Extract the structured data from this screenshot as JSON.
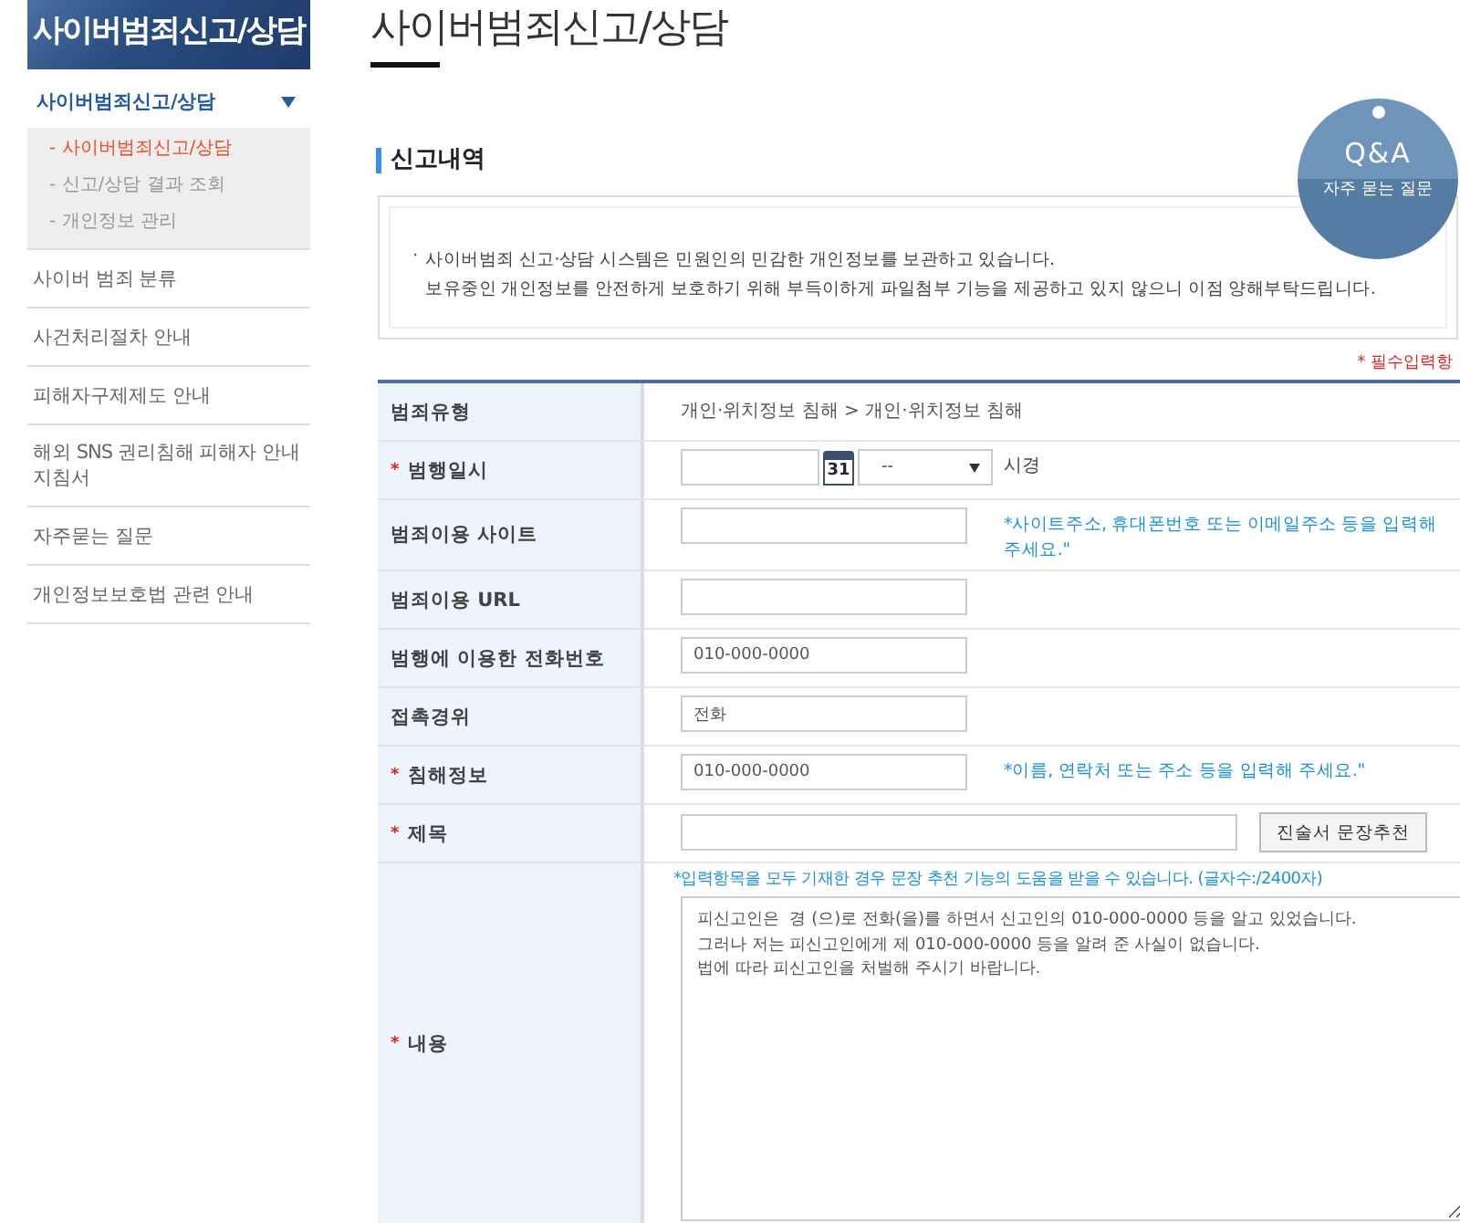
{
  "sidebar": {
    "banner": "사이버범죄신고/상담",
    "menu": [
      {
        "label": "사이버범죄신고/상담",
        "selected": true,
        "expanded": true,
        "children": [
          {
            "label": "- 사이버범죄신고/상담",
            "selected": true
          },
          {
            "label": "- 신고/상담 결과 조회",
            "selected": false
          },
          {
            "label": "- 개인정보 관리",
            "selected": false
          }
        ]
      },
      {
        "label": "사이버 범죄 분류",
        "selected": false,
        "expanded": false
      },
      {
        "label": "사건처리절차 안내",
        "selected": false,
        "expanded": false
      },
      {
        "label": "피해자구제제도 안내",
        "selected": false,
        "expanded": false
      },
      {
        "label": "해외 SNS 권리침해 피해자 안내 지침서",
        "selected": false,
        "expanded": false
      },
      {
        "label": "자주묻는 질문",
        "selected": false,
        "expanded": false
      },
      {
        "label": "개인정보보호법 관련 안내",
        "selected": false,
        "expanded": false
      }
    ]
  },
  "page_title": "사이버범죄신고/상담",
  "section_title": "신고내역",
  "qa": {
    "title": "Q&A",
    "subtitle": "자주 묻는 질문"
  },
  "notice": {
    "bullet": "·",
    "text": "사이버범죄 신고·상담 시스템은 민원인의 민감한 개인정보를 보관하고 있습니다.\n보유중인 개인정보를 안전하게 보호하기 위해 부득이하게 파일첨부 기능을 제공하고 있지 않으니 이점 양해부탁드립니다."
  },
  "required_note": "* 필수입력항",
  "form": {
    "required_mark": "*",
    "rows": [
      {
        "kind": "text",
        "label": "범죄유형",
        "required": false,
        "value": "개인·위치정보 침해 > 개인·위치정보 침해"
      },
      {
        "kind": "date",
        "label": "범행일시",
        "required": true,
        "value": "",
        "calendar_day": "31",
        "time": "--",
        "suffix": "시경"
      },
      {
        "kind": "input",
        "label": "범죄이용 사이트",
        "required": false,
        "value": "",
        "hint": "*사이트주소, 휴대폰번호 또는 이메일주소 등을 입력해 주세요.\""
      },
      {
        "kind": "input",
        "label": "범죄이용 URL",
        "required": false,
        "value": ""
      },
      {
        "kind": "input",
        "label": "범행에 이용한 전화번호",
        "required": false,
        "value": "010-000-0000"
      },
      {
        "kind": "input",
        "label": "접촉경위",
        "required": false,
        "value": "전화"
      },
      {
        "kind": "input",
        "label": "침해정보",
        "required": true,
        "value": "010-000-0000",
        "hint": "*이름, 연락처 또는 주소 등을 입력해 주세요.\""
      },
      {
        "kind": "input_button",
        "label": "제목",
        "required": true,
        "value": "",
        "button": "진술서 문장추천"
      },
      {
        "kind": "textarea",
        "label": "내용",
        "required": true,
        "hint": "*입력항목을 모두 기재한 경우 문장 추천 기능의 도움을 받을 수 있습니다. (글자수:/2400자)",
        "value": "피신고인은  경 (으)로 전화(을)를 하면서 신고인의 010-000-0000 등을 알고 있었습니다.\n그러나 저는 피신고인에게 제 010-000-0000 등을 알려 준 사실이 없습니다.\n법에 따라 피신고인을 처벌해 주시기 바랍니다."
      }
    ]
  }
}
